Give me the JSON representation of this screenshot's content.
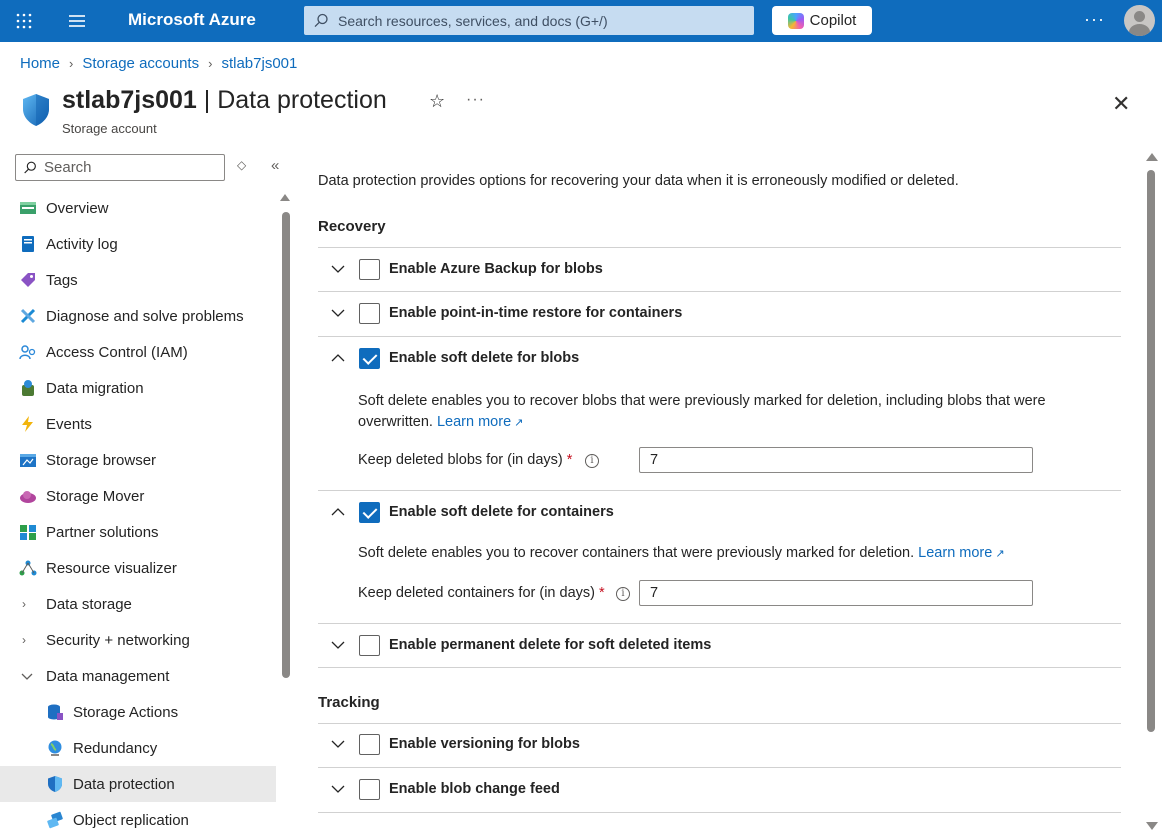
{
  "topbar": {
    "brand": "Microsoft Azure",
    "search_placeholder": "Search resources, services, and docs (G+/)",
    "copilot_label": "Copilot",
    "more_label": "···"
  },
  "breadcrumb": [
    "Home",
    "Storage accounts",
    "stlab7js001"
  ],
  "page": {
    "resource_name": "stlab7js001",
    "blade_title": " | Data protection",
    "subtitle": "Storage account",
    "more_label": "···"
  },
  "sidebar": {
    "search_placeholder": "Search",
    "items": [
      {
        "label": "Overview",
        "icon": "overview-icon",
        "color": "#3aa06a"
      },
      {
        "label": "Activity log",
        "icon": "activity-log-icon",
        "color": "#0f6cbd"
      },
      {
        "label": "Tags",
        "icon": "tag-icon",
        "color": "#8a53c4"
      },
      {
        "label": "Diagnose and solve problems",
        "icon": "wrench-icon",
        "color": "#1a8ad4"
      },
      {
        "label": "Access Control (IAM)",
        "icon": "people-icon",
        "color": "#2b88d8"
      },
      {
        "label": "Data migration",
        "icon": "migration-icon",
        "color": "#4c7a33"
      },
      {
        "label": "Events",
        "icon": "lightning-icon",
        "color": "#f2b40c"
      },
      {
        "label": "Storage browser",
        "icon": "storage-browser-icon",
        "color": "#1e74c6"
      },
      {
        "label": "Storage Mover",
        "icon": "cloud-icon",
        "color": "#b1459d"
      },
      {
        "label": "Partner solutions",
        "icon": "partner-icon",
        "color": "#2d9f4a"
      },
      {
        "label": "Resource visualizer",
        "icon": "visualizer-icon",
        "color": "#1f8ad3"
      },
      {
        "label": "Data storage",
        "icon": "chevron-right-icon"
      },
      {
        "label": "Security + networking",
        "icon": "chevron-right-icon"
      },
      {
        "label": "Data management",
        "icon": "chevron-down-icon"
      },
      {
        "label": "Storage Actions",
        "icon": "storage-actions-icon",
        "color": "#1f6fc2"
      },
      {
        "label": "Redundancy",
        "icon": "globe-icon",
        "color": "#2f8ee0"
      },
      {
        "label": "Data protection",
        "icon": "shield-icon",
        "color": "#1f6fc2",
        "active": true
      },
      {
        "label": "Object replication",
        "icon": "replication-icon",
        "color": "#2a86d1"
      }
    ]
  },
  "content": {
    "description": "Data protection provides options for recovering your data when it is erroneously modified or deleted.",
    "recovery_title": "Recovery",
    "tracking_title": "Tracking",
    "rows": {
      "azure_backup": "Enable Azure Backup for blobs",
      "pitr": "Enable point-in-time restore for containers",
      "soft_delete_blobs": "Enable soft delete for blobs",
      "soft_delete_containers": "Enable soft delete for containers",
      "permanent_delete": "Enable permanent delete for soft deleted items",
      "versioning": "Enable versioning for blobs",
      "change_feed": "Enable blob change feed"
    },
    "soft_delete_blobs_desc": "Soft delete enables you to recover blobs that were previously marked for deletion, including blobs that were overwritten.",
    "soft_delete_containers_desc": "Soft delete enables you to recover containers that were previously marked for deletion.",
    "learn_more": "Learn more",
    "keep_blobs_label": "Keep deleted blobs for (in days)",
    "keep_blobs_value": "7",
    "keep_containers_label": "Keep deleted containers for (in days)",
    "keep_containers_value": "7",
    "required_mark": "*"
  }
}
